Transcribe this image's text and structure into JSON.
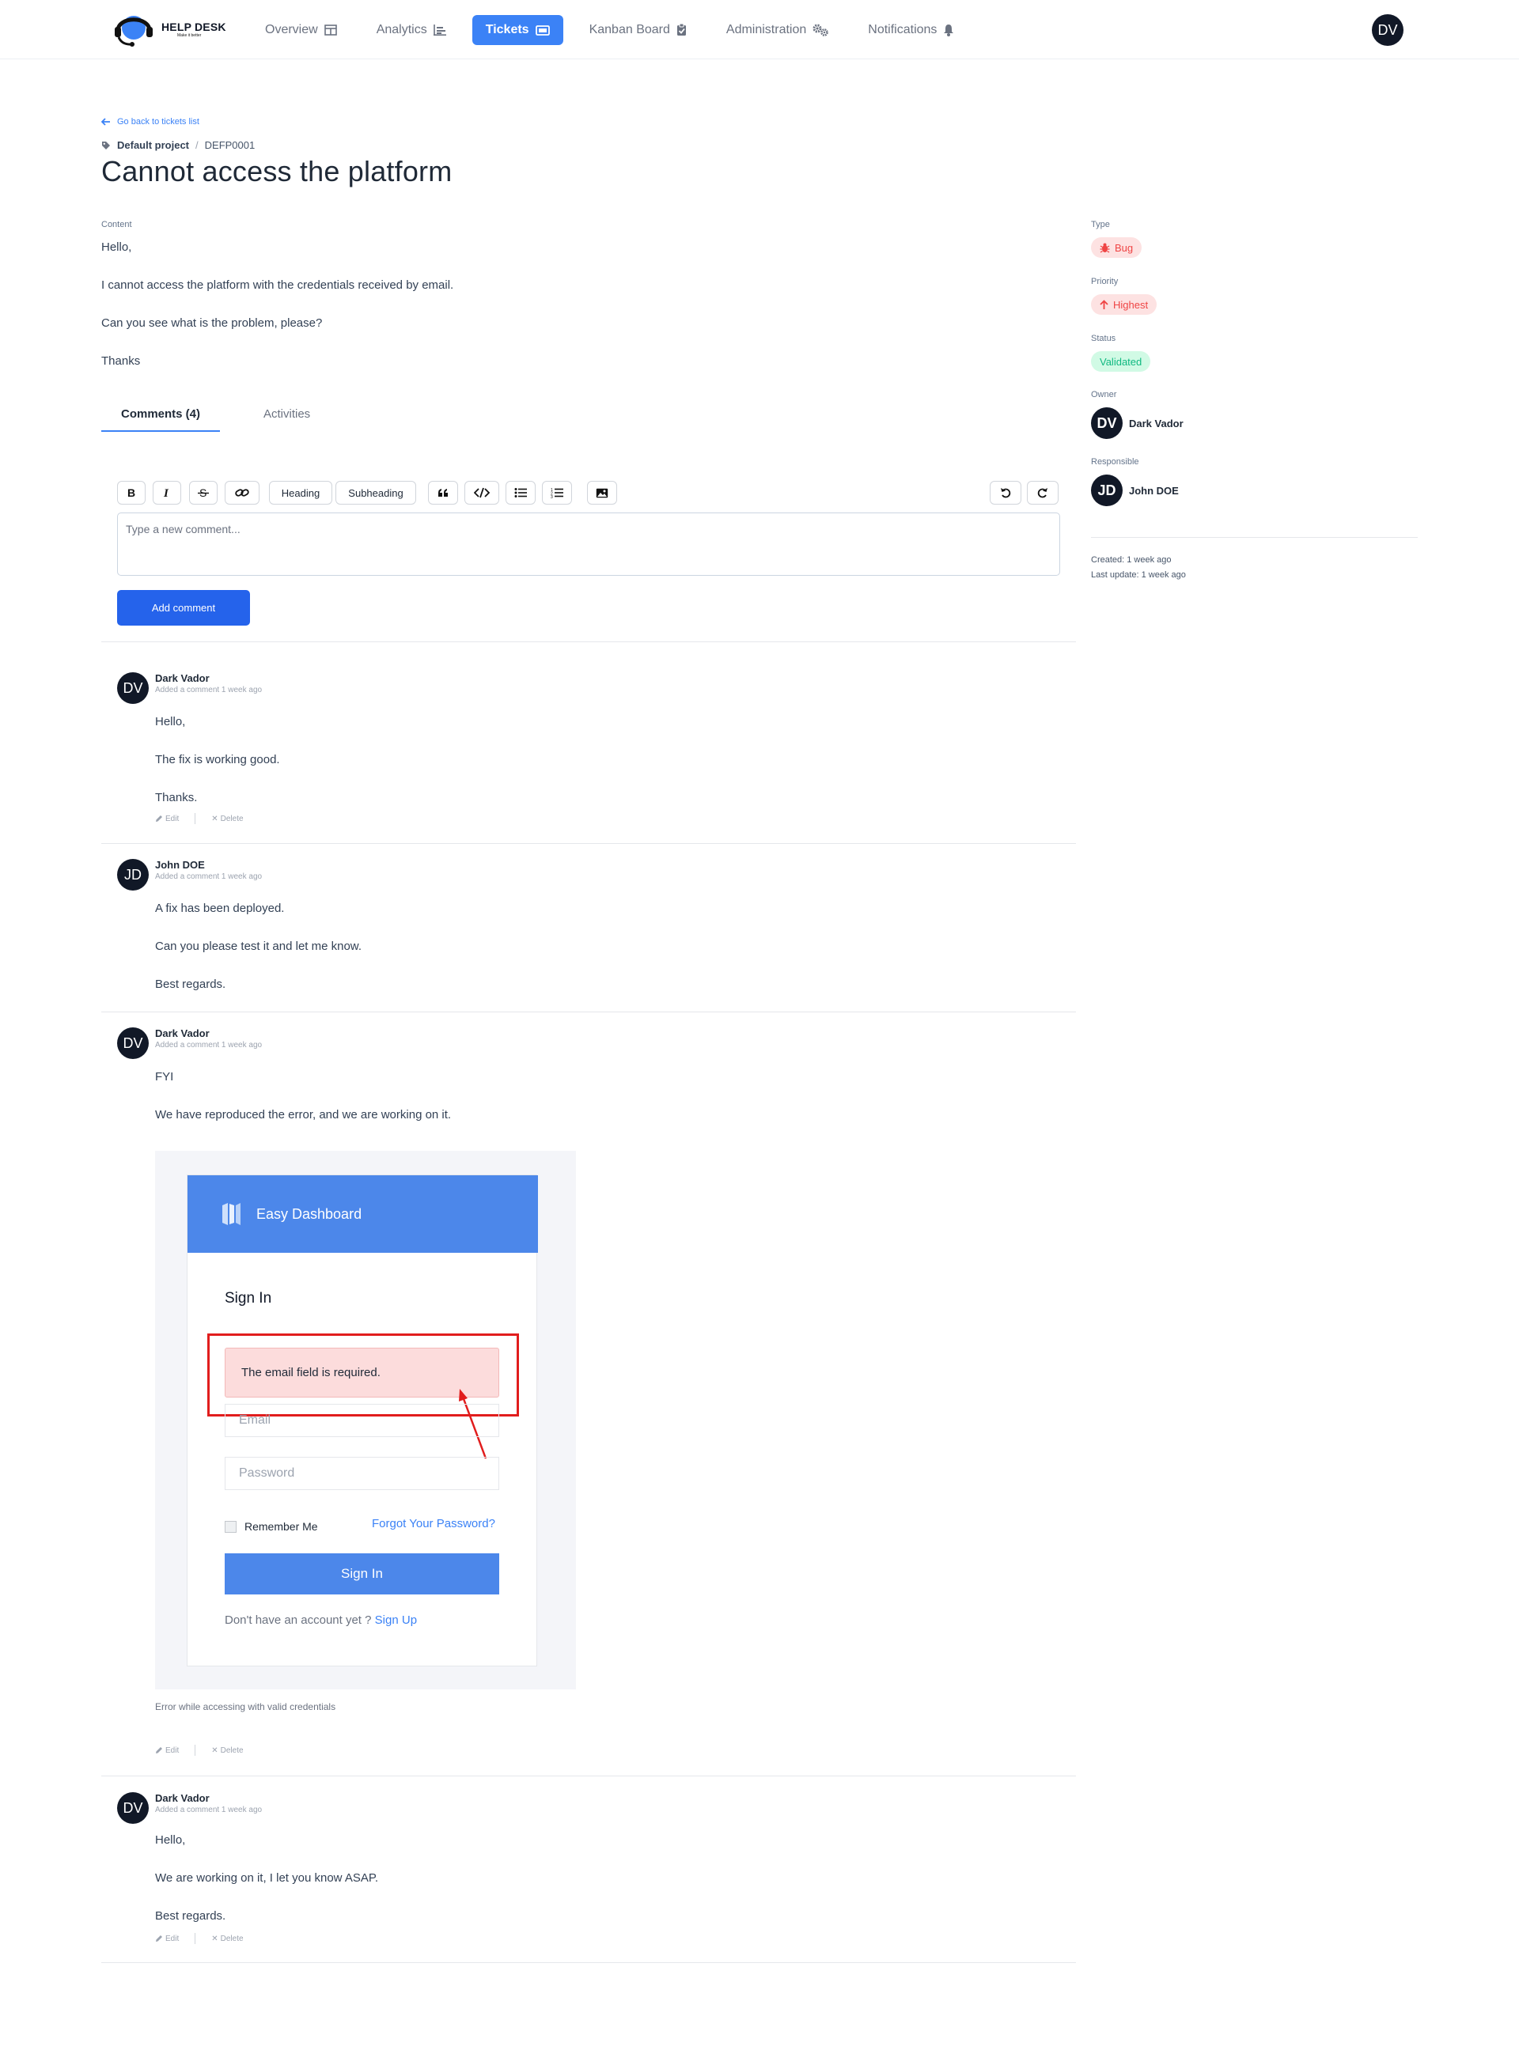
{
  "app": {
    "logo_title": "HELP DESK",
    "logo_tagline": "Make it better",
    "user_initials": "DV"
  },
  "nav": [
    {
      "label": "Overview",
      "icon": "table-icon",
      "active": false
    },
    {
      "label": "Analytics",
      "icon": "bar-chart-icon",
      "active": false
    },
    {
      "label": "Tickets",
      "icon": "ticket-icon",
      "active": true
    },
    {
      "label": "Kanban Board",
      "icon": "clipboard-check-icon",
      "active": false
    },
    {
      "label": "Administration",
      "icon": "cogs-icon",
      "active": false
    },
    {
      "label": "Notifications",
      "icon": "bell-icon",
      "active": false
    }
  ],
  "ticket": {
    "back_label": "Go back to tickets list",
    "project": "Default project",
    "code": "DEFP0001",
    "title": "Cannot access the platform",
    "content_label": "Content",
    "content": [
      "Hello,",
      "I cannot access the platform with the credentials received by email.",
      "Can you see what is the problem, please?",
      "Thanks"
    ]
  },
  "tabs": {
    "comments": "Comments (4)",
    "activities": "Activities"
  },
  "editor": {
    "heading": "Heading",
    "subheading": "Subheading",
    "placeholder": "Type a new comment...",
    "add_button": "Add comment"
  },
  "comments": [
    {
      "initials": "DV",
      "author": "Dark Vador",
      "meta": "Added a comment 1 week ago",
      "lines": [
        "Hello,",
        "The fix is working good.",
        "Thanks."
      ],
      "edit": "Edit",
      "delete": "Delete"
    },
    {
      "initials": "JD",
      "author": "John DOE",
      "meta": "Added a comment 1 week ago",
      "lines": [
        "A fix has been deployed.",
        "Can you please test it and let me know.",
        "Best regards."
      ]
    },
    {
      "initials": "DV",
      "author": "Dark Vador",
      "meta": "Added a comment 1 week ago",
      "lines": [
        "FYI",
        "We have reproduced the error, and we are working on it."
      ],
      "image_caption": "Error while accessing with valid credentials",
      "edit": "Edit",
      "delete": "Delete"
    },
    {
      "initials": "DV",
      "author": "Dark Vador",
      "meta": "Added a comment 1 week ago",
      "lines": [
        "Hello,",
        "We are working on it, I let you know ASAP.",
        "Best regards."
      ],
      "edit": "Edit",
      "delete": "Delete"
    }
  ],
  "embedded_screenshot": {
    "brand": "Easy Dashboard",
    "heading": "Sign In",
    "error": "The email field is required.",
    "email_placeholder": "Email",
    "password_placeholder": "Password",
    "remember": "Remember Me",
    "forgot": "Forgot Your Password?",
    "sign_in": "Sign In",
    "no_account": "Don't have an account yet ?",
    "sign_up": "Sign Up"
  },
  "sidebar": {
    "type_label": "Type",
    "type": "Bug",
    "priority_label": "Priority",
    "priority": "Highest",
    "status_label": "Status",
    "status": "Validated",
    "owner_label": "Owner",
    "owner_initials": "DV",
    "owner": "Dark Vador",
    "responsible_label": "Responsible",
    "responsible_initials": "JD",
    "responsible": "John DOE",
    "created": "Created: 1 week ago",
    "updated": "Last update: 1 week ago"
  },
  "colors": {
    "accent": "#3b82f6",
    "button": "#2563eb",
    "avatar_bg": "#111827",
    "danger": "#ef4444",
    "success": "#10b981",
    "annotation_red": "#e11d1d"
  }
}
